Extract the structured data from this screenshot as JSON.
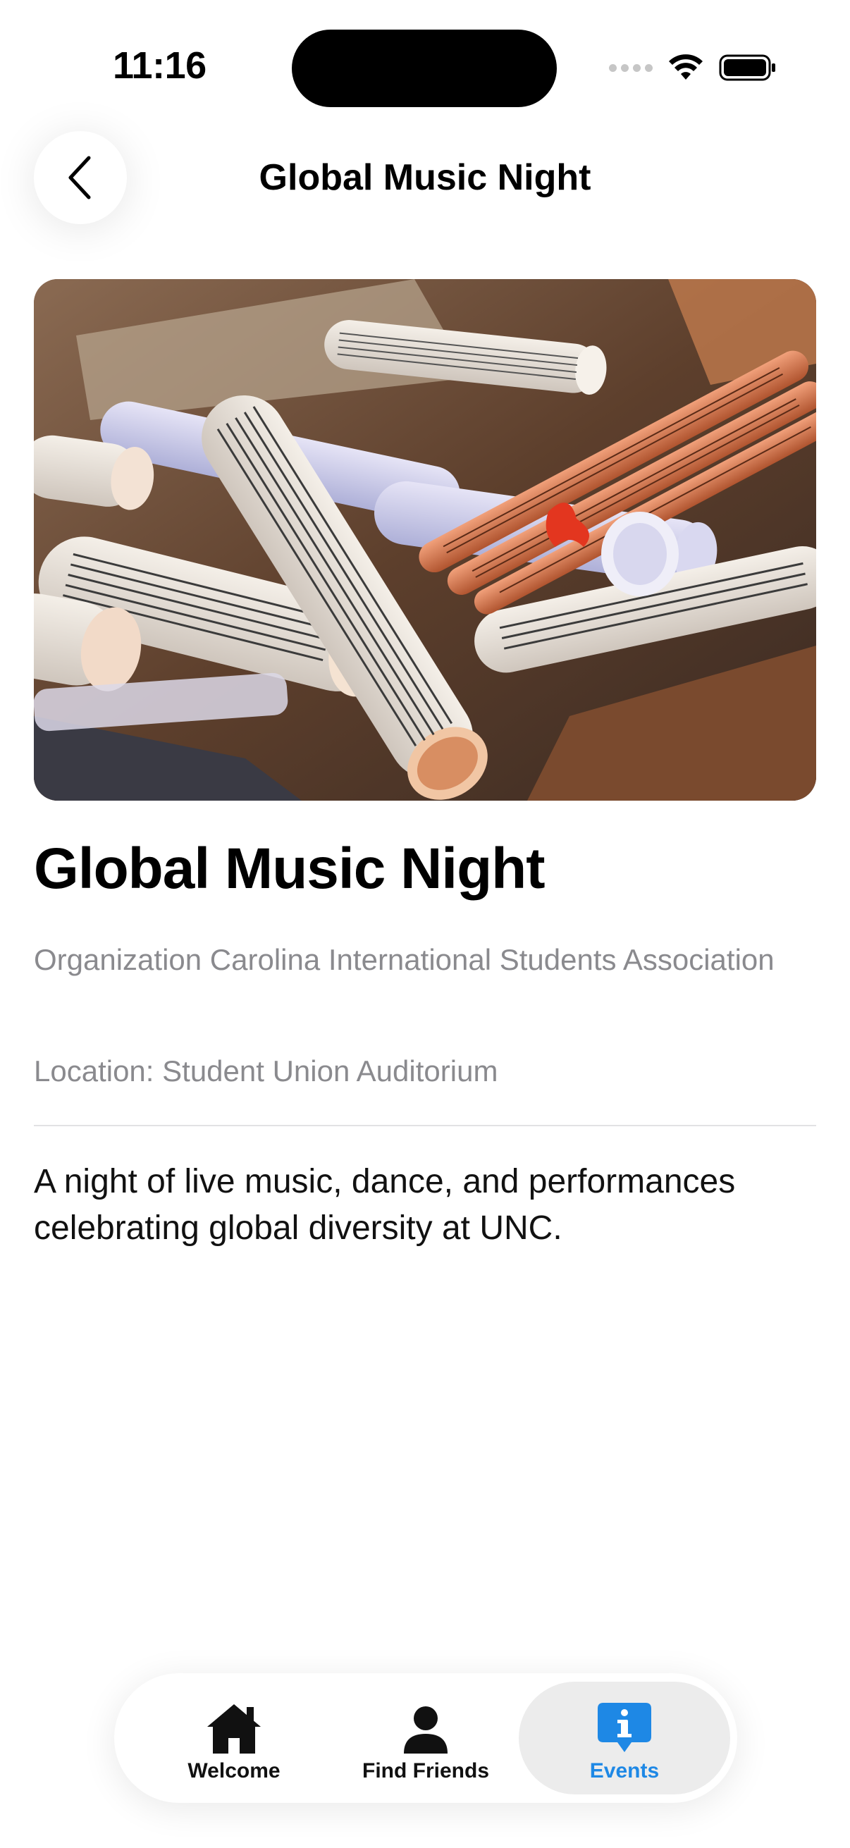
{
  "status_bar": {
    "time": "11:16"
  },
  "nav": {
    "title": "Global Music Night",
    "back_icon": "chevron-left-icon"
  },
  "hero_image": {
    "subject": "rolled-sheet-music-photo"
  },
  "event": {
    "title": "Global Music Night",
    "organization": "Organization Carolina International Students Association",
    "location": "Location: Student Union Auditorium",
    "description": "A night of live music, dance, and performances celebrating global diversity at UNC."
  },
  "tabbar": {
    "tabs": [
      {
        "label": "Welcome",
        "icon": "house-icon",
        "active": false
      },
      {
        "label": "Find Friends",
        "icon": "person-icon",
        "active": false
      },
      {
        "label": "Events",
        "icon": "info-bubble-icon",
        "active": true
      }
    ]
  },
  "colors": {
    "accent": "#1e88e5",
    "secondary_text": "#8a8a8e",
    "active_tab_bg": "#ececec"
  }
}
